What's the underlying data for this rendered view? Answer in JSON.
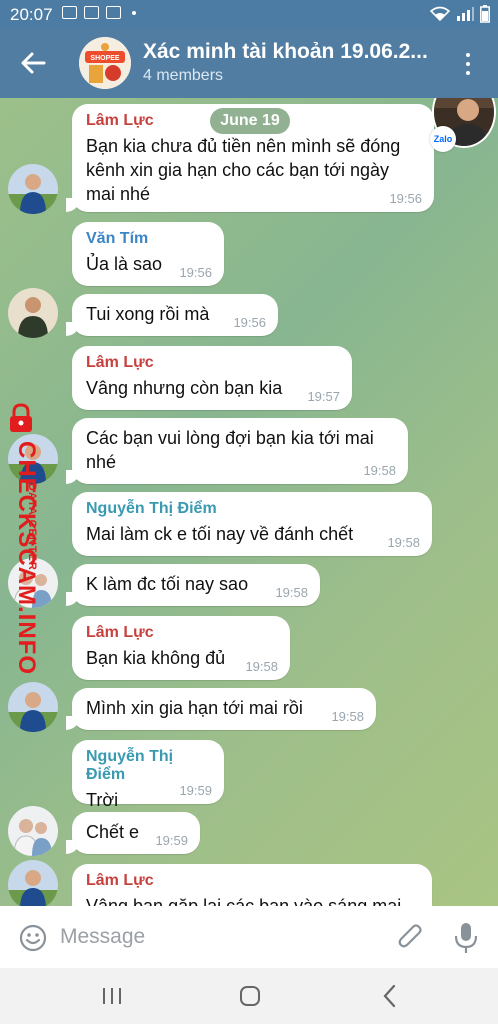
{
  "status_bar": {
    "time": "20:07",
    "battery_icon": "battery-icon",
    "signal_icon": "signal-icon",
    "wifi_icon": "wifi-icon"
  },
  "header": {
    "title": "Xác minh tài khoản 19.06.2...",
    "subtitle": "4 members",
    "avatar_text": "SHOPEE"
  },
  "date_pill": "June 19",
  "colors": {
    "header": "#517da2",
    "sender_red": "#c7423f",
    "sender_blue": "#3c86c5",
    "sender_teal": "#3a9ab2",
    "watermark": "#e21d1d"
  },
  "messages": [
    {
      "sender": "Lâm Lực",
      "text": "Bạn kia chưa đủ tiền nên mình sẽ đóng kênh xin gia hạn cho các bạn tới ngày mai nhé",
      "time": "19:56"
    },
    {
      "sender": "Văn Tím",
      "text": "Ủa là sao",
      "time": "19:56"
    },
    {
      "sender": "",
      "text": "Tui xong rồi mà",
      "time": "19:56"
    },
    {
      "sender": "Lâm Lực",
      "text": "Vâng nhưng còn bạn kia",
      "time": "19:57"
    },
    {
      "sender": "",
      "text": "Các bạn vui lòng đợi bạn kia tới mai nhé",
      "time": "19:58"
    },
    {
      "sender": "Nguyễn Thị Điểm",
      "text": "Mai làm ck e tối nay về đánh chết",
      "time": "19:58"
    },
    {
      "sender": "",
      "text": "K làm đc tối nay sao",
      "time": "19:58"
    },
    {
      "sender": "Lâm Lực",
      "text": "Bạn kia không đủ",
      "time": "19:58"
    },
    {
      "sender": "",
      "text": "Mình xin gia hạn tới mai rồi",
      "time": "19:58"
    },
    {
      "sender": "Nguyễn Thị Điểm",
      "text": "Trời",
      "time": "19:59"
    },
    {
      "sender": "",
      "text": "Chết e",
      "time": "19:59"
    },
    {
      "sender": "Lâm Lực",
      "text": "Vâng bạn gặp lại các bạn vào sáng mai",
      "time": ""
    }
  ],
  "watermark": {
    "main": "CHECKSCAM.INFO",
    "small": "DATA CENTER"
  },
  "zalo_badge": "Zalo",
  "input": {
    "placeholder": "Message"
  }
}
